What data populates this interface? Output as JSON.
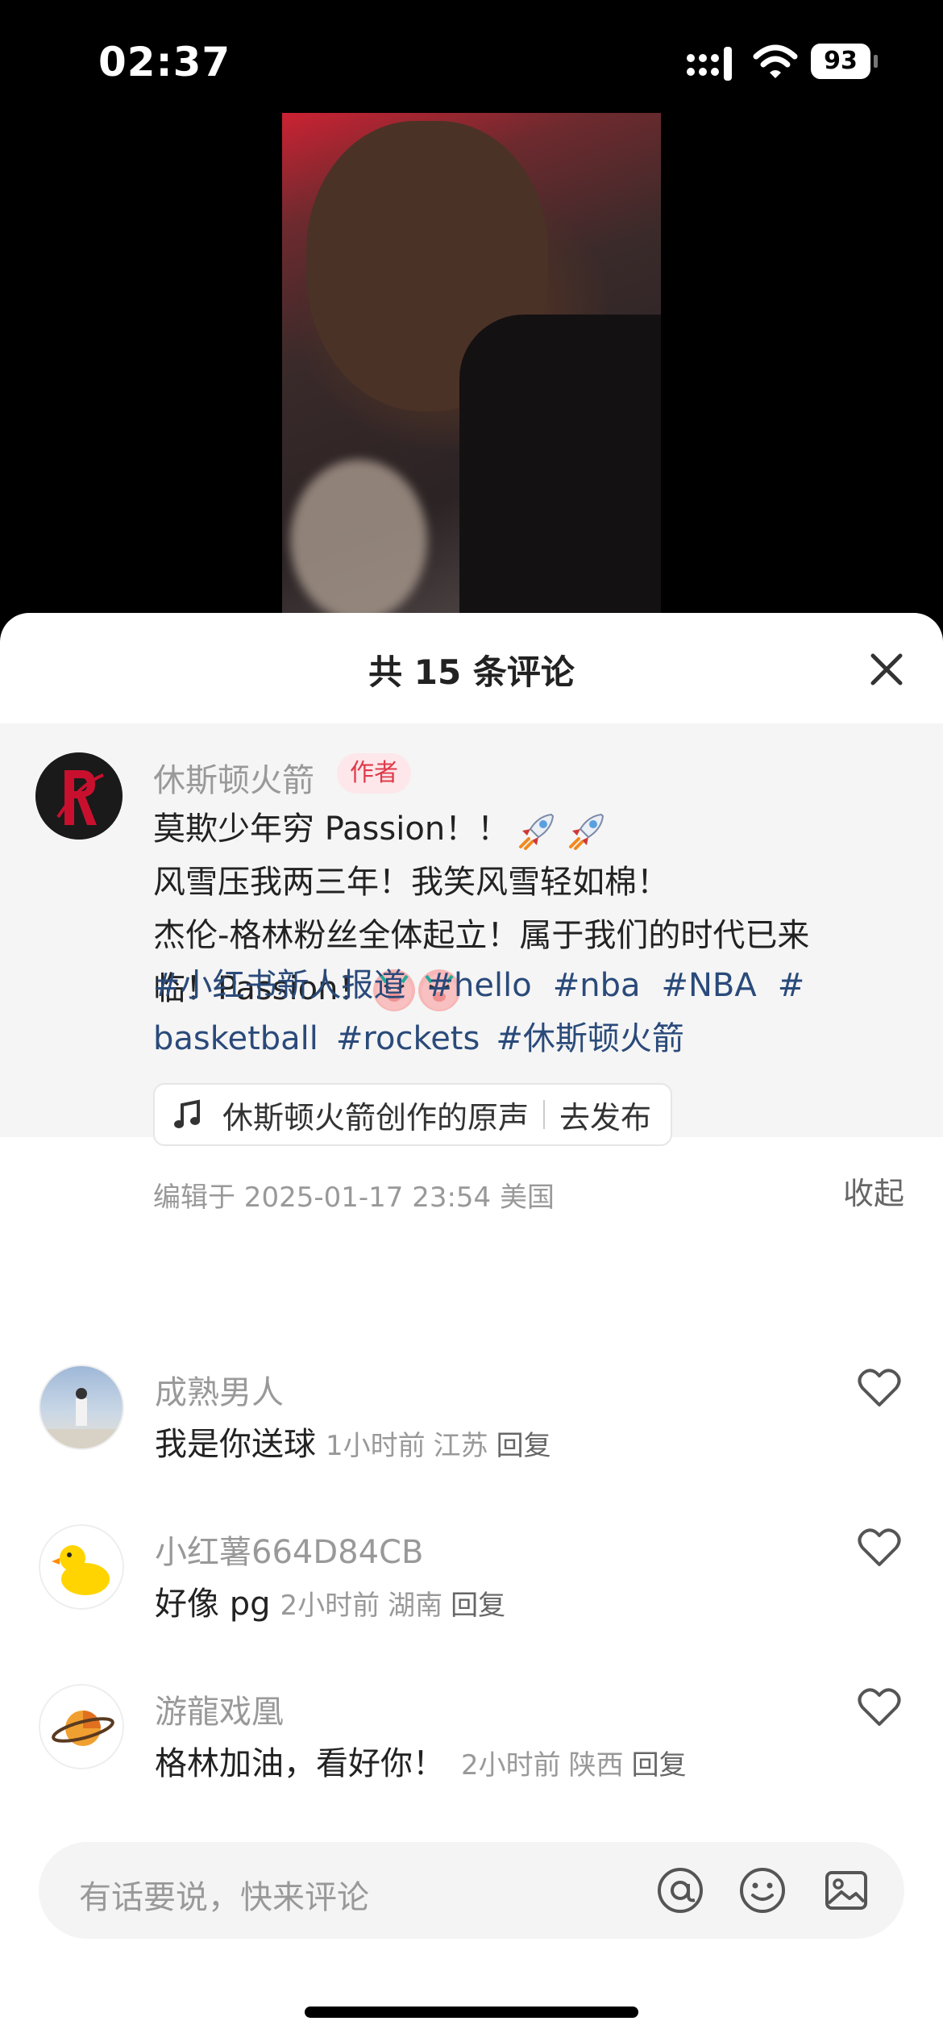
{
  "status_bar": {
    "time": "02:37",
    "battery": "93"
  },
  "sheet": {
    "title": "共 15 条评论"
  },
  "author_comment": {
    "name": "休斯顿火箭",
    "tag": "作者",
    "lines": [
      "莫欺少年穷 Passion！！",
      "风雪压我两三年！我笑风雪轻如棉！",
      "杰伦-格林粉丝全体起立！属于我们的时代已来",
      "临！Passion！"
    ],
    "hashtags": [
      "#小红书新人报道",
      "#hello",
      "#nba",
      "#NBA",
      "#",
      "basketball",
      "#rockets",
      "#休斯顿火箭"
    ],
    "music": {
      "label": "休斯顿火箭创作的原声",
      "action": "去发布"
    },
    "edit_info": "编辑于  2025-01-17 23:54 美国",
    "collapse": "收起"
  },
  "comments": [
    {
      "name": "成熟男人",
      "text": "我是你送球",
      "time": "1小时前",
      "location": "江苏",
      "reply": "回复"
    },
    {
      "name": "小红薯664D84CB",
      "text": "好像 pg",
      "time": "2小时前",
      "location": "湖南",
      "reply": "回复"
    },
    {
      "name": "游龍戏凰",
      "text": "格林加油，看好你！",
      "time": "2小时前",
      "location": "陕西",
      "reply": "回复"
    }
  ],
  "input": {
    "placeholder": "有话要说，快来评论"
  },
  "icons": [
    "rocket-emoji",
    "pig-emoji",
    "music-note-icon",
    "heart-icon",
    "at-icon",
    "smile-icon",
    "image-icon",
    "close-icon"
  ]
}
